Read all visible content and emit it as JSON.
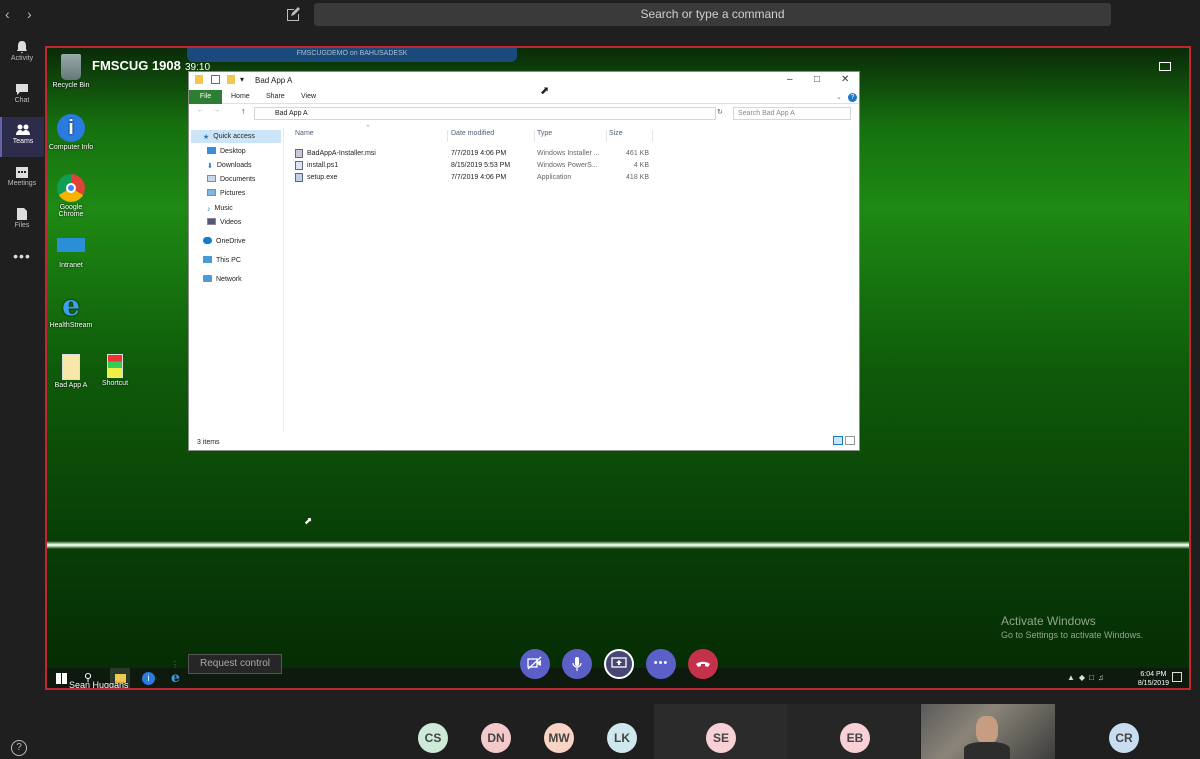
{
  "app": {
    "search_placeholder": "Search or type a command"
  },
  "rail": {
    "items": [
      {
        "label": "Activity",
        "icon": "bell-icon"
      },
      {
        "label": "Chat",
        "icon": "chat-icon"
      },
      {
        "label": "Teams",
        "icon": "teams-icon",
        "active": true
      },
      {
        "label": "Meetings",
        "icon": "calendar-icon"
      },
      {
        "label": "Files",
        "icon": "file-icon"
      },
      {
        "label": "...",
        "icon": "more-icon"
      }
    ],
    "help_label": "?"
  },
  "meeting": {
    "title": "FMSCUG 1908",
    "elapsed": "39:10",
    "presenter": "Sean Huggans",
    "request_control_label": "Request control"
  },
  "remote_desktop": {
    "connection_bar": "FMSCUGDEMO on BAHUSADESK",
    "desktop_icons": [
      {
        "label": "Recycle Bin",
        "icon": "recycle-bin-icon"
      },
      {
        "label": "Computer Info",
        "icon": "info-icon"
      },
      {
        "label": "Google Chrome",
        "icon": "chrome-icon"
      },
      {
        "label": "Intranet",
        "icon": "intranet-icon"
      },
      {
        "label": "HealthStream",
        "icon": "ie-icon"
      },
      {
        "label": "Bad App A",
        "icon": "folder-icon"
      },
      {
        "label": "Shortcut",
        "icon": "shortcut-icon"
      }
    ],
    "watermark": {
      "line1": "Activate Windows",
      "line2": "Go to Settings to activate Windows."
    },
    "taskbar": {
      "time": "6:04 PM",
      "date": "8/15/2019"
    }
  },
  "explorer": {
    "title": "Bad App A",
    "ribbon_tabs": [
      "File",
      "Home",
      "Share",
      "View"
    ],
    "address": "Bad App A",
    "search_placeholder": "Search Bad App A",
    "nav": [
      {
        "label": "Quick access",
        "selected": true
      },
      {
        "label": "Desktop"
      },
      {
        "label": "Downloads"
      },
      {
        "label": "Documents"
      },
      {
        "label": "Pictures"
      },
      {
        "label": "Music"
      },
      {
        "label": "Videos"
      },
      {
        "label": "OneDrive"
      },
      {
        "label": "This PC"
      },
      {
        "label": "Network"
      }
    ],
    "columns": [
      "Name",
      "Date modified",
      "Type",
      "Size"
    ],
    "files": [
      {
        "name": "BadAppA-Installer.msi",
        "date": "7/7/2019 4:06 PM",
        "type": "Windows Installer ...",
        "size": "461 KB"
      },
      {
        "name": "install.ps1",
        "date": "8/15/2019 5:53 PM",
        "type": "Windows PowerS...",
        "size": "4 KB"
      },
      {
        "name": "setup.exe",
        "date": "7/7/2019 4:06 PM",
        "type": "Application",
        "size": "418 KB"
      }
    ],
    "status": "3 items"
  },
  "call_controls": [
    "camera-off-icon",
    "microphone-icon",
    "share-screen-icon",
    "more-icon",
    "hang-up-icon"
  ],
  "participants": [
    {
      "initials": "CS",
      "color": "#cde9d8"
    },
    {
      "initials": "DN",
      "color": "#f4c9cc"
    },
    {
      "initials": "MW",
      "color": "#f9d4c4"
    },
    {
      "initials": "LK",
      "color": "#cfe8ee"
    },
    {
      "initials": "SE",
      "color": "#f7d1d6"
    },
    {
      "initials": "EB",
      "color": "#f7d1d6"
    },
    {
      "initials": "CR",
      "color": "#c9ddf0"
    }
  ]
}
